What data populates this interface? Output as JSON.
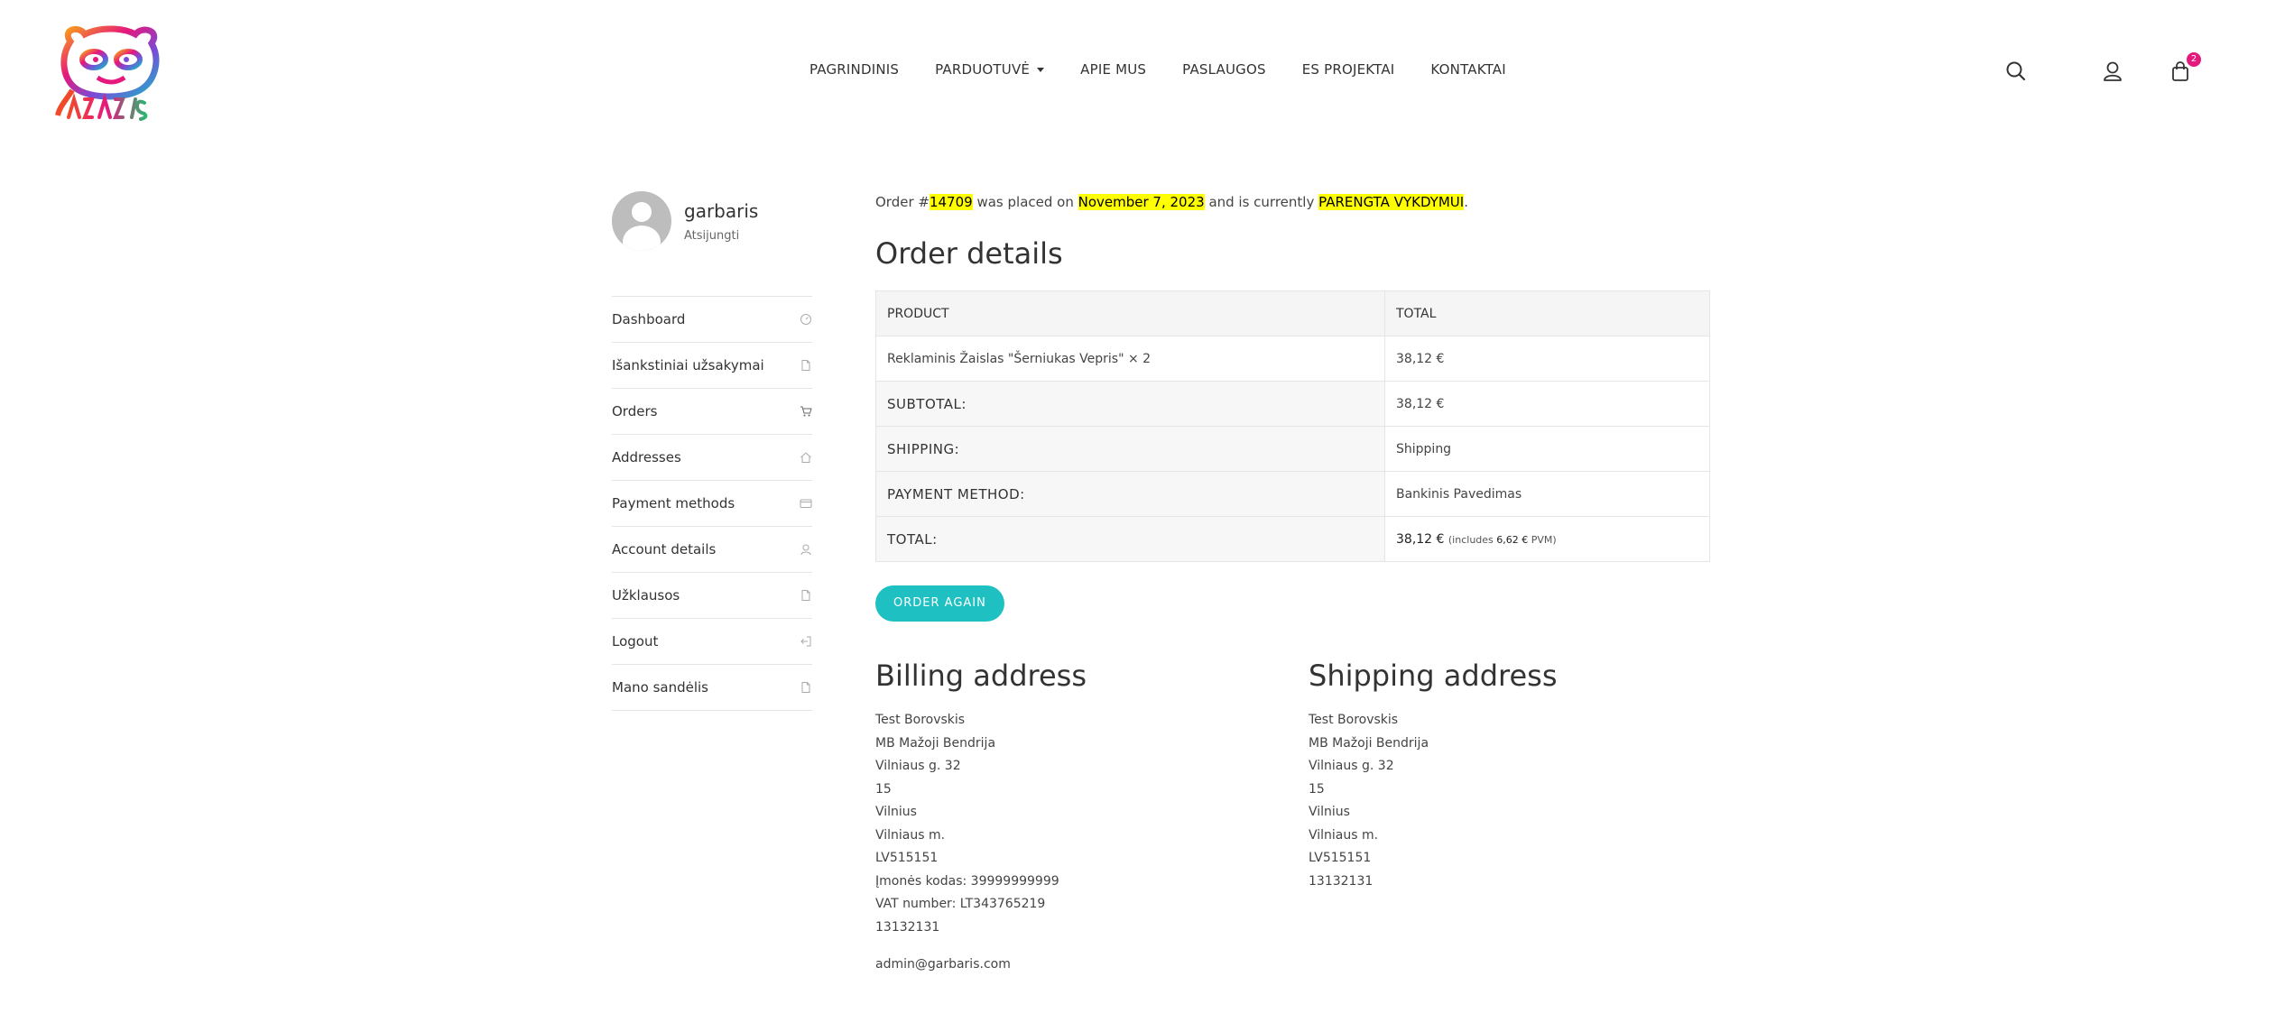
{
  "header": {
    "nav": [
      {
        "label": "PAGRINDINIS"
      },
      {
        "label": "PARDUOTUVĖ",
        "has_dropdown": true
      },
      {
        "label": "APIE MUS"
      },
      {
        "label": "PASLAUGOS"
      },
      {
        "label": "ES PROJEKTAI"
      },
      {
        "label": "KONTAKTAI"
      }
    ],
    "icons": {
      "search": "search-icon",
      "account": "user-icon",
      "cart": "shopping-bag-icon"
    },
    "cart_count": "2",
    "accent_color": "#e6187b"
  },
  "user": {
    "name": "garbaris",
    "status": "Atsijungti"
  },
  "menu": [
    {
      "label": "Dashboard",
      "icon": "dashboard-icon"
    },
    {
      "label": "Išankstiniai užsakymai",
      "icon": "document-icon"
    },
    {
      "label": "Orders",
      "icon": "cart-icon"
    },
    {
      "label": "Addresses",
      "icon": "home-icon"
    },
    {
      "label": "Payment methods",
      "icon": "credit-card-icon"
    },
    {
      "label": "Account details",
      "icon": "user-icon"
    },
    {
      "label": "Užklausos",
      "icon": "document-icon"
    },
    {
      "label": "Logout",
      "icon": "logout-icon"
    },
    {
      "label": "Mano sandėlis",
      "icon": "document-icon"
    }
  ],
  "order": {
    "notice_prefix": "Order #",
    "number": "14709",
    "notice_mid1": " was placed on ",
    "date": "November 7, 2023",
    "notice_mid2": " and is currently ",
    "status": "PARENGTA VYKDYMUI",
    "notice_end": ".",
    "heading": "Order details",
    "table": {
      "col_product": "PRODUCT",
      "col_total": "TOTAL",
      "item_name": "Reklaminis Žaislas \"Šerniukas Vepris\"",
      "item_qty": " × 2",
      "item_total": "38,12 €",
      "subtotal_label": "SUBTOTAL:",
      "subtotal_value": "38,12 €",
      "shipping_label": "SHIPPING:",
      "shipping_value": "Shipping",
      "payment_label": "PAYMENT METHOD:",
      "payment_value": "Bankinis Pavedimas",
      "total_label": "TOTAL:",
      "total_value": "38,12 €",
      "total_note_prefix": "(includes ",
      "total_note_tax": "6,62 €",
      "total_note_suffix": " PVM)"
    },
    "order_again": "ORDER AGAIN",
    "accent": "#1ec0c1",
    "highlight": "#ffff00"
  },
  "billing": {
    "heading": "Billing address",
    "lines": [
      "Test Borovskis",
      "MB Mažoji Bendrija",
      "Vilniaus g. 32",
      "15",
      "Vilnius",
      "Vilniaus m.",
      "LV515151",
      "Įmonės kodas: 39999999999",
      "VAT number: LT343765219",
      "13132131"
    ],
    "email": "admin@garbaris.com"
  },
  "shipping": {
    "heading": "Shipping address",
    "lines": [
      "Test Borovskis",
      "MB Mažoji Bendrija",
      "Vilniaus g. 32",
      "15",
      "Vilnius",
      "Vilniaus m.",
      "LV515151",
      "13132131"
    ]
  }
}
